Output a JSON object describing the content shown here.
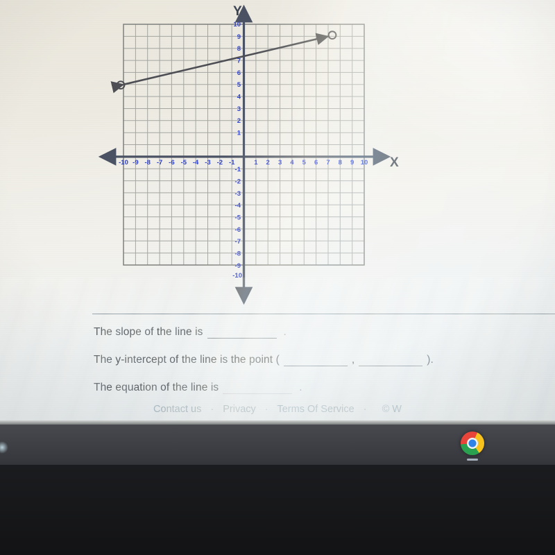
{
  "graph": {
    "axis_label_x": "X",
    "axis_label_y": "Y",
    "x_ticks_negative": [
      "-10",
      "-9",
      "-8",
      "-7",
      "-6",
      "-5",
      "-4",
      "-3",
      "-2",
      "-1"
    ],
    "x_ticks_positive": [
      "1",
      "2",
      "3",
      "4",
      "5",
      "6",
      "7",
      "8",
      "9",
      "10"
    ],
    "y_ticks_positive": [
      "1",
      "2",
      "3",
      "4",
      "5",
      "6",
      "7",
      "8",
      "9",
      "10"
    ],
    "y_ticks_negative": [
      "-1",
      "-2",
      "-3",
      "-4",
      "-5",
      "-6",
      "-7",
      "-8",
      "-9",
      "-10"
    ],
    "tick_color": "#2b3fd0",
    "axis_color": "#4a5264",
    "grid_color": "#8d8f8c",
    "line_color": "#4d4f55"
  },
  "chart_data": {
    "type": "line",
    "title": "",
    "xlabel": "X",
    "ylabel": "Y",
    "xlim": [
      -10,
      10
    ],
    "ylim": [
      -10,
      10
    ],
    "grid": true,
    "legend": "none",
    "series": [
      {
        "name": "line segment",
        "x": [
          -10,
          7
        ],
        "y": [
          4,
          10
        ],
        "endpoint_style": "open-circle",
        "arrowheads": "both",
        "slope": 0.3529,
        "y_intercept": 7
      }
    ],
    "annotations": [
      {
        "label": "open circle endpoint",
        "x": -10,
        "y": 4
      },
      {
        "label": "open circle endpoint",
        "x": 7,
        "y": 10
      }
    ]
  },
  "questions": [
    {
      "id": "slope",
      "prefix": "The slope of the line is",
      "blank_value": "",
      "suffix": ".",
      "blanks": 1
    },
    {
      "id": "y-intercept",
      "prefix": "The y-intercept of the line is the point (",
      "middle": ",",
      "suffix": ").",
      "blank_x_value": "",
      "blank_y_value": "",
      "blanks": 2
    },
    {
      "id": "equation",
      "prefix": "The equation of the line is",
      "blank_value": "",
      "suffix": ".",
      "blanks": 1
    }
  ],
  "footer": {
    "links": [
      "Contact us",
      "Privacy",
      "Terms Of Service"
    ],
    "separator": "·",
    "copyright": "© W"
  },
  "taskbar": {
    "app_label": "Chrome"
  }
}
